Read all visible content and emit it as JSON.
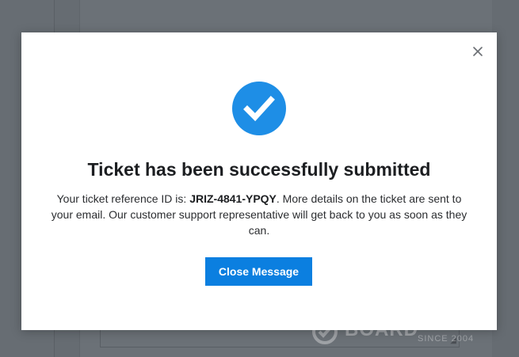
{
  "background": {
    "watermark": {
      "brand": "BOARD",
      "tagline": "SINCE 2004"
    }
  },
  "modal": {
    "close_icon": "close-icon",
    "success_icon": "check-circle-icon",
    "title": "Ticket has been successfully submitted",
    "message": {
      "prefix": "Your ticket reference ID is: ",
      "ticket_id": "JRIZ-4841-YPQY",
      "suffix": ". More details on the ticket are sent to your email. Our customer support representative will get back to you as soon as they can."
    },
    "button_label": "Close Message"
  },
  "colors": {
    "overlay": "#666c72",
    "accent": "#0b7fe0",
    "success_icon": "#1e8ee6",
    "title": "#1c1e21"
  }
}
